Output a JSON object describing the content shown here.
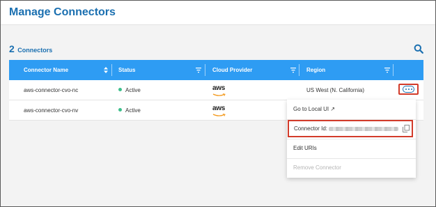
{
  "page": {
    "title": "Manage Connectors"
  },
  "summary": {
    "count": "2",
    "label": "Connectors"
  },
  "table": {
    "headers": [
      "Connector Name",
      "Status",
      "Cloud Provider",
      "Region"
    ],
    "rows": [
      {
        "name": "aws-connector-cvo-nc",
        "status": "Active",
        "provider": "aws",
        "region": "US West (N. California)"
      },
      {
        "name": "aws-connector-cvo-nv",
        "status": "Active",
        "provider": "aws",
        "region": ""
      }
    ]
  },
  "menu": {
    "go_local": "Go to Local UI ↗",
    "connector_id_label": "Connector Id:",
    "edit_uris": "Edit URIs",
    "remove": "Remove Connector"
  },
  "colors": {
    "accent": "#1a6fb0",
    "header": "#2e9cf3",
    "active": "#3dbf8b",
    "highlight": "#d23b2a"
  },
  "icons": [
    "search-icon",
    "sort-icon",
    "filter-icon",
    "more-options-icon",
    "copy-icon",
    "aws-logo"
  ]
}
